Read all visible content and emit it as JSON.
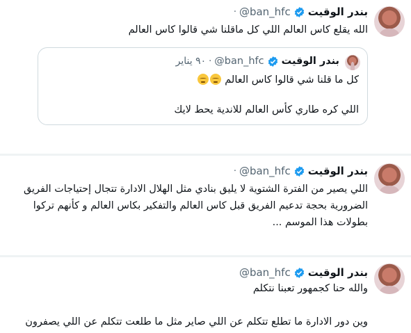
{
  "tweets": [
    {
      "name": "بندر الوقيت",
      "handle": "@ban_hfc",
      "separator": "·",
      "text_lines": [
        "الله يقلع كاس العالم اللي كل ماقلنا شي قالوا كاس العالم"
      ],
      "quote": {
        "name": "بندر الوقيت",
        "handle": "@ban_hfc",
        "separator": "·",
        "date": "٩٠ يناير",
        "line1": "كل ما قلنا شي قالوا كاس العالم",
        "line2": "اللي كره طاري كأس العالم للاندية يحط لايك"
      }
    },
    {
      "name": "بندر الوقيت",
      "handle": "@ban_hfc",
      "separator": "·",
      "text_lines": [
        "اللي يصير من الفترة الشتوية لا يليق بنادي مثل الهلال الادارة تتجال إحتياجات الفريق",
        "الضرورية بحجة تدعيم الفريق قبل كاس العالم والتفكير بكاس العالم و كأنهم تركوا",
        "بطولات هذا الموسم ..."
      ]
    },
    {
      "name": "بندر الوقيت",
      "handle": "@ban_hfc",
      "separator": "",
      "text_lines": [
        "والله حنا كجمهور تعبنا نتكلم",
        "",
        "وين دور الادارة ما تطلع تتكلم عن اللي صاير مثل ما طلعت تتكلم عن اللي يصفرون"
      ]
    }
  ],
  "icons": {
    "verified": "verified-badge-icon",
    "avatar": "user-avatar",
    "emoji": "relieved-face-emoji"
  },
  "colors": {
    "verified": "#1d9bf0",
    "secondary_text": "#536471",
    "border": "#cfd9de",
    "divider": "#eff3f4"
  }
}
